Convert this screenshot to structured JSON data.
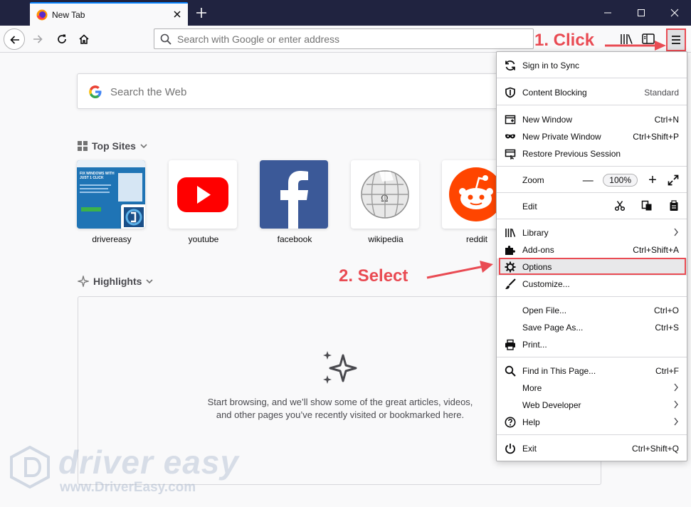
{
  "browser": {
    "tab_title": "New Tab",
    "url_placeholder": "Search with Google or enter address"
  },
  "page": {
    "search_placeholder": "Search the Web",
    "top_sites_title": "Top Sites",
    "top_sites": [
      {
        "label": "drivereasy",
        "icon": "drivereasy-thumbnail"
      },
      {
        "label": "youtube",
        "icon": "youtube-logo"
      },
      {
        "label": "facebook",
        "icon": "facebook-logo"
      },
      {
        "label": "wikipedia",
        "icon": "wikipedia-globe"
      },
      {
        "label": "reddit",
        "icon": "reddit-logo"
      }
    ],
    "drivereasy_thumb_text": "FIX WINDOWS WITH JUST 1 CLICK",
    "highlights_title": "Highlights",
    "highlights_empty_text": "Start browsing, and we’ll show some of the great articles, videos, and other pages you’ve recently visited or bookmarked here."
  },
  "menu": {
    "sign_in": "Sign in to Sync",
    "content_blocking": "Content Blocking",
    "content_blocking_value": "Standard",
    "new_window": "New Window",
    "new_window_shortcut": "Ctrl+N",
    "new_private_window": "New Private Window",
    "new_private_window_shortcut": "Ctrl+Shift+P",
    "restore_session": "Restore Previous Session",
    "zoom": "Zoom",
    "zoom_value": "100%",
    "zoom_minus": "—",
    "zoom_plus": "+",
    "edit": "Edit",
    "library": "Library",
    "addons": "Add-ons",
    "addons_shortcut": "Ctrl+Shift+A",
    "options": "Options",
    "customize": "Customize...",
    "open_file": "Open File...",
    "open_file_shortcut": "Ctrl+O",
    "save_page": "Save Page As...",
    "save_page_shortcut": "Ctrl+S",
    "print": "Print...",
    "find": "Find in This Page...",
    "find_shortcut": "Ctrl+F",
    "more": "More",
    "web_developer": "Web Developer",
    "help": "Help",
    "exit": "Exit",
    "exit_shortcut": "Ctrl+Shift+Q"
  },
  "annotations": {
    "step1": "1. Click",
    "step2": "2. Select"
  },
  "watermark": {
    "title": "driver easy",
    "url": "www.DriverEasy.com"
  },
  "colors": {
    "annotation_red": "#e94b53",
    "titlebar": "#202340",
    "accent_blue": "#0a84ff"
  }
}
